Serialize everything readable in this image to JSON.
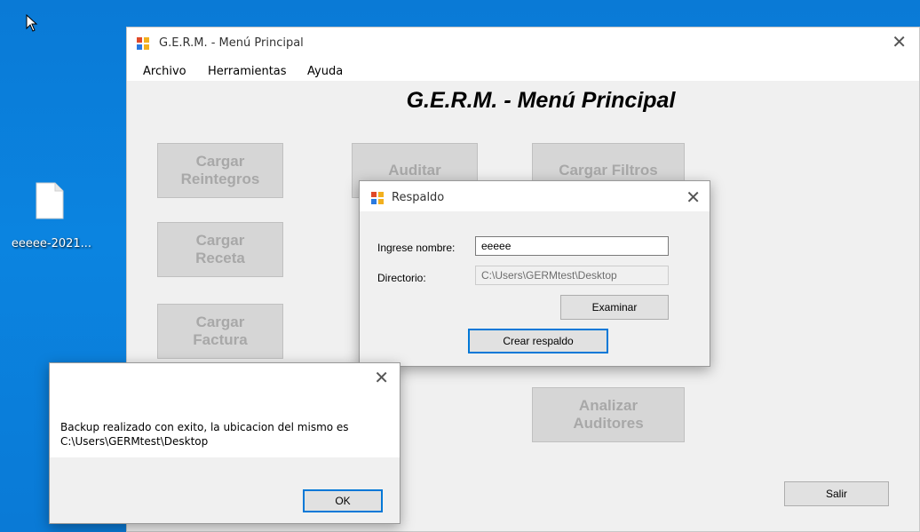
{
  "desktop": {
    "icon_label": "eeeee-2021...",
    "accent": "#0a7ad6"
  },
  "main_window": {
    "title": "G.E.R.M. - Menú Principal",
    "close_glyph": "✕",
    "menu": [
      "Archivo",
      "Herramientas",
      "Ayuda"
    ],
    "heading": "G.E.R.M. - Menú Principal",
    "buttons": {
      "cargar_reintegros": "Cargar\nReintegros",
      "auditar": "Auditar",
      "cargar_filtros": "Cargar Filtros",
      "cargar_receta": "Cargar\nReceta",
      "cargar_factura": "Cargar\nFactura",
      "analizar_auditores": "Analizar\nAuditores",
      "salir": "Salir"
    }
  },
  "respaldo_dialog": {
    "title": "Respaldo",
    "close_glyph": "✕",
    "nombre_label": "Ingrese nombre:",
    "nombre_value": "eeeee",
    "directorio_label": "Directorio:",
    "directorio_value": "C:\\Users\\GERMtest\\Desktop",
    "examinar_label": "Examinar",
    "crear_label": "Crear respaldo"
  },
  "message_box": {
    "close_glyph": "✕",
    "line1": "Backup realizado con exito, la ubicacion del mismo es",
    "line2": "C:\\Users\\GERMtest\\Desktop",
    "ok_label": "OK"
  }
}
